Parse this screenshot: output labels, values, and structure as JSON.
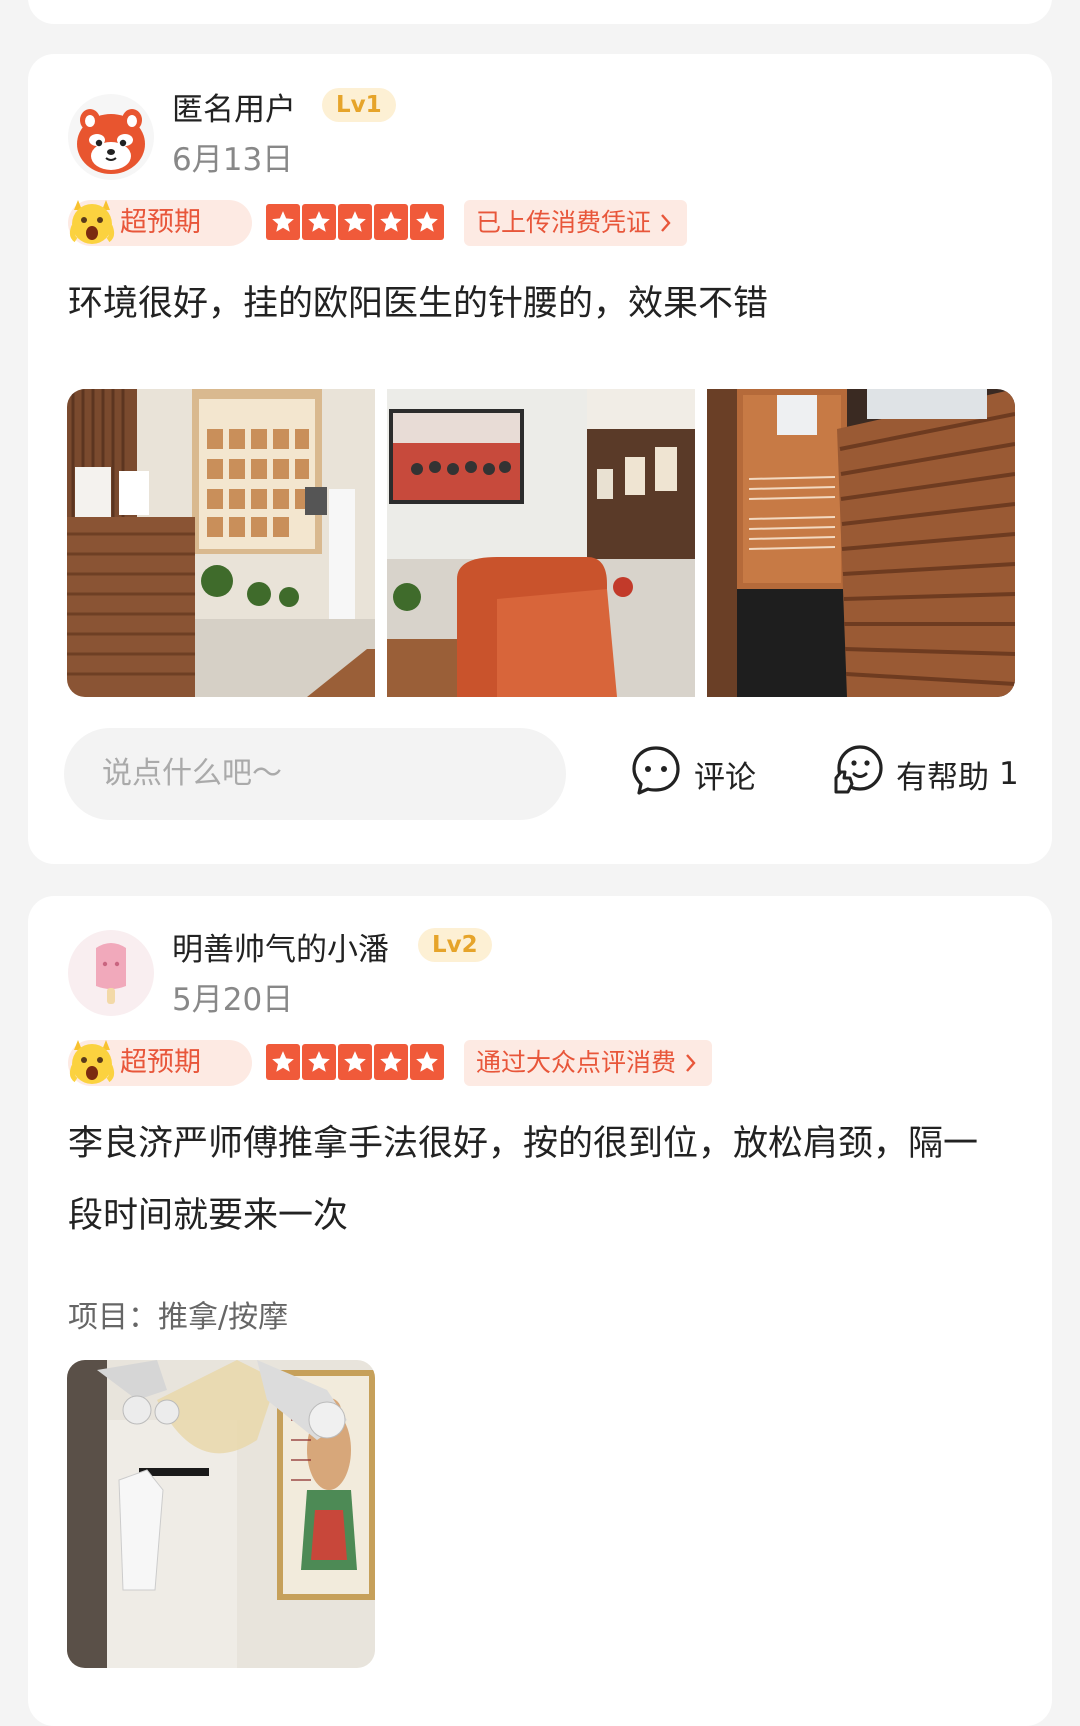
{
  "reviews": [
    {
      "username": "匿名用户",
      "level": "Lv1",
      "date": "6月13日",
      "exceed_label": "超预期",
      "rating_stars": 5,
      "voucher_label": "已上传消费凭证",
      "text": "环境很好，挂的欧阳医生的针腰的，效果不错",
      "comment_placeholder": "说点什么吧～",
      "comment_label": "评论",
      "helpful_label": "有帮助",
      "helpful_count": "1",
      "avatar_icon": "red-panda-avatar-icon"
    },
    {
      "username": "明善帅气的小潘",
      "level": "Lv2",
      "date": "5月20日",
      "exceed_label": "超预期",
      "rating_stars": 5,
      "voucher_label": "通过大众点评消费",
      "text": "李良济严师傅推拿手法很好，按的很到位，放松肩颈，隔一段时间就要来一次",
      "project_label": "项目：",
      "project_value": "推拿/按摩",
      "avatar_icon": "popsicle-avatar-icon"
    }
  ],
  "colors": {
    "accent": "#f05a3a",
    "tag_bg": "#fdeae3",
    "level_bg": "#fdf0d4",
    "level_text": "#e6a42a"
  }
}
